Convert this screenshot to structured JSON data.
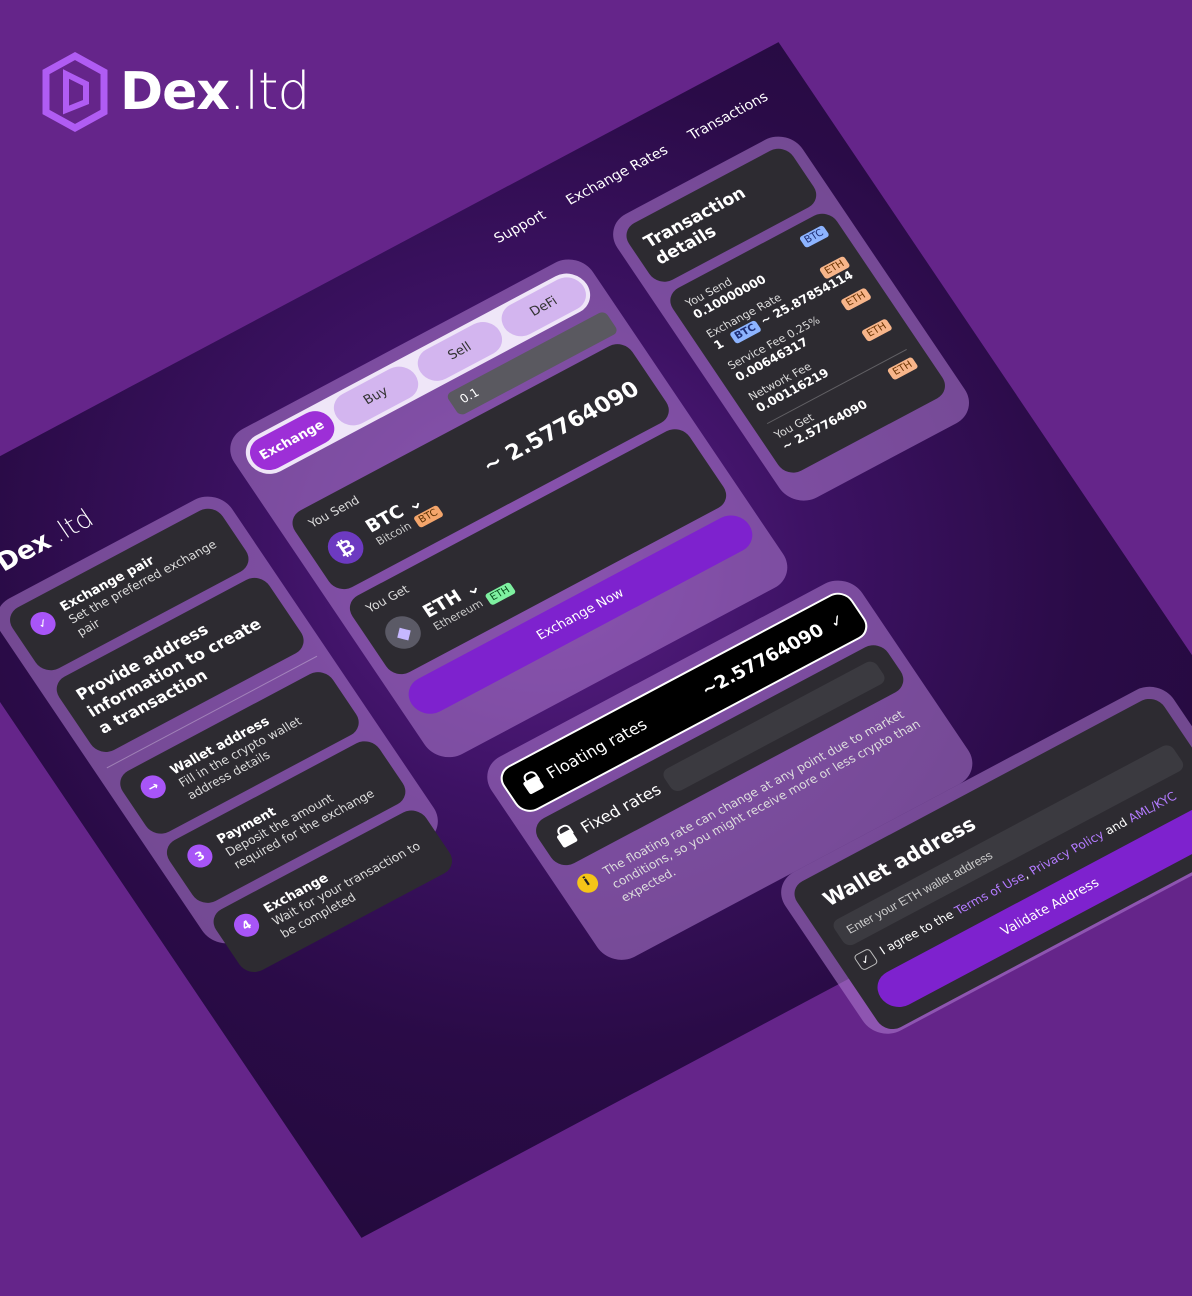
{
  "brand": {
    "name_bold": "Dex",
    "name_light": ".ltd"
  },
  "nav": {
    "support": "Support",
    "exchange_rates": "Exchange Rates",
    "transactions": "Transactions"
  },
  "steps": {
    "exchange_pair": {
      "title": "Exchange pair",
      "desc": "Set the preferred exchange pair"
    },
    "heading": "Provide address information to create a transaction",
    "wallet": {
      "title": "Wallet address",
      "desc": "Fill in the crypto wallet address details"
    },
    "payment": {
      "num": "3",
      "title": "Payment",
      "desc": "Deposit the amount required for the exchange"
    },
    "exchange": {
      "num": "4",
      "title": "Exchange",
      "desc": "Wait for your transaction to be completed"
    }
  },
  "exchange": {
    "tabs": [
      "Exchange",
      "Buy",
      "Sell",
      "DeFi"
    ],
    "amount": "0.1",
    "send": {
      "label": "You Send",
      "symbol": "BTC",
      "name": "Bitcoin",
      "tag": "BTC",
      "value": "~ 2.57764090"
    },
    "get": {
      "label": "You Get",
      "symbol": "ETH",
      "name": "Ethereum",
      "tag": "ETH"
    },
    "button": "Exchange Now"
  },
  "details": {
    "title": "Transaction details",
    "send_tag": "BTC",
    "send_label": "You Send",
    "send_value": "0.10000000",
    "rate_label": "Exchange Rate",
    "rate_tag": "ETH",
    "rate_left": "1",
    "rate_left_tag": "BTC",
    "rate_tilde": "~",
    "rate_value": "25.87854114",
    "fee_label": "Service Fee 0.25%",
    "fee_value": "0.00646317",
    "fee_tag": "ETH",
    "network_label": "Network Fee",
    "network_value": "0.00116219",
    "network_tag": "ETH",
    "get_label": "You Get",
    "get_tag": "ETH",
    "get_tilde": "~",
    "get_value": "2.57764090"
  },
  "rates": {
    "floating": "Floating rates",
    "floating_value": "~2.57764090",
    "fixed": "Fixed rates",
    "info": "The floating rate can change at any point due to market conditions, so you might receive more or less crypto than expected."
  },
  "wallet": {
    "title": "Wallet address",
    "placeholder": "Enter your ETH wallet address",
    "agree_prefix": "I agree to the",
    "terms": "Terms of Use",
    "privacy": "Privacy Policy",
    "and": "and",
    "aml": "AML/KYC",
    "button": "Validate Address"
  }
}
